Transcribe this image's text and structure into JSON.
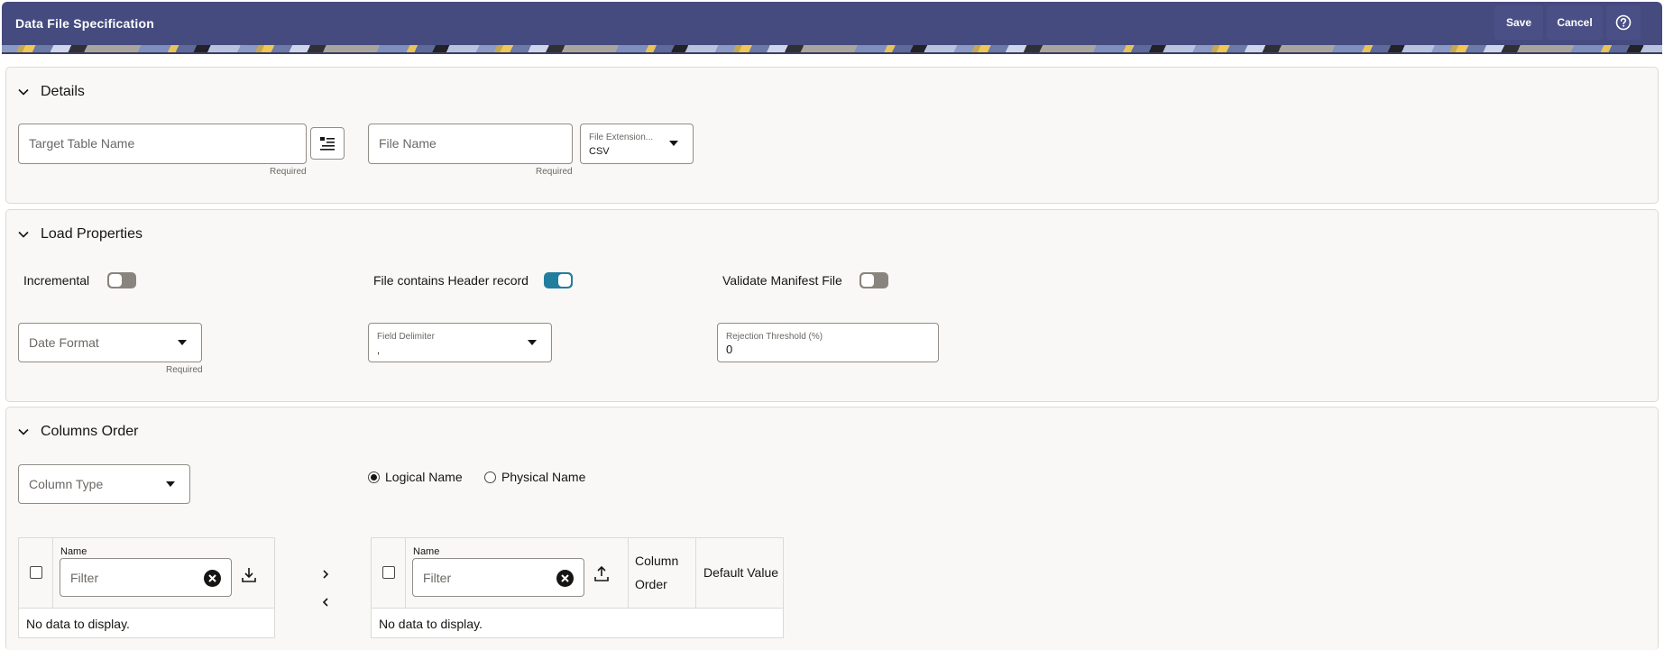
{
  "header": {
    "title": "Data File Specification",
    "save_label": "Save",
    "cancel_label": "Cancel",
    "help_icon": "help-circle-icon"
  },
  "details": {
    "title": "Details",
    "target_table": {
      "placeholder": "Target Table Name",
      "value": "",
      "helper": "Required"
    },
    "file_name": {
      "placeholder": "File Name",
      "value": "",
      "helper": "Required"
    },
    "file_extension": {
      "label": "File Extension...",
      "value": "CSV"
    }
  },
  "load_properties": {
    "title": "Load Properties",
    "incremental": {
      "label": "Incremental",
      "on": false
    },
    "header_record": {
      "label": "File contains Header record",
      "on": true
    },
    "validate_manifest": {
      "label": "Validate Manifest File",
      "on": false
    },
    "date_format": {
      "placeholder": "Date Format",
      "helper": "Required"
    },
    "field_delimiter": {
      "label": "Field Delimiter",
      "value": ","
    },
    "rejection_threshold": {
      "label": "Rejection Threshold (%)",
      "value": "0"
    }
  },
  "columns_order": {
    "title": "Columns Order",
    "column_type": {
      "placeholder": "Column Type"
    },
    "name_mode": {
      "options": [
        "Logical Name",
        "Physical Name"
      ],
      "selected": "Logical Name"
    },
    "available_table": {
      "columns": [
        "Name"
      ],
      "filter_placeholder": "Filter",
      "empty_text": "No data to display."
    },
    "selected_table": {
      "columns": [
        "Name",
        "Column",
        "Order",
        "Default Value"
      ],
      "filter_placeholder": "Filter",
      "empty_text": "No data to display."
    },
    "move_right_label": ">",
    "move_left_label": "<"
  },
  "colors": {
    "header_bg": "#454b7e",
    "toggle_on": "#227e9e",
    "toggle_off": "#8a847e",
    "section_bg": "#f9f8f6"
  }
}
